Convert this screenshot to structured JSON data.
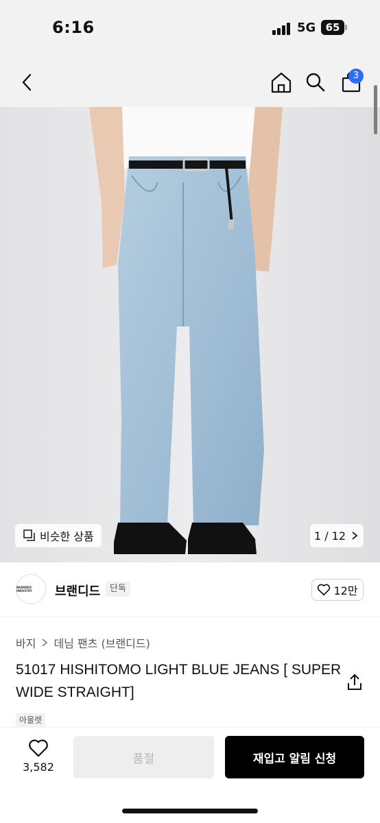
{
  "status_bar": {
    "time": "6:16",
    "network": "5G",
    "battery": "65"
  },
  "nav": {
    "cart_count": "3"
  },
  "image": {
    "similar_label": "비슷한 상품",
    "page_counter": "1 / 12"
  },
  "brand": {
    "logo_text": "BRANDED INDUSTRY",
    "name": "브랜디드",
    "tag": "단독",
    "likes": "12만"
  },
  "breadcrumb": {
    "category": "바지",
    "subcategory": "데님 팬츠 (브랜디드)"
  },
  "product": {
    "title": "51017 HISHITOMO LIGHT BLUE JEANS [ SUPER WIDE STRAIGHT]",
    "tag": "아울렛"
  },
  "bottom": {
    "wish_count": "3,582",
    "soldout_label": "품절",
    "restock_label": "재입고 알림 신청"
  },
  "colors": {
    "accent": "#2f6cf6",
    "primary_button": "#000000",
    "disabled_button": "#eeeeee"
  }
}
